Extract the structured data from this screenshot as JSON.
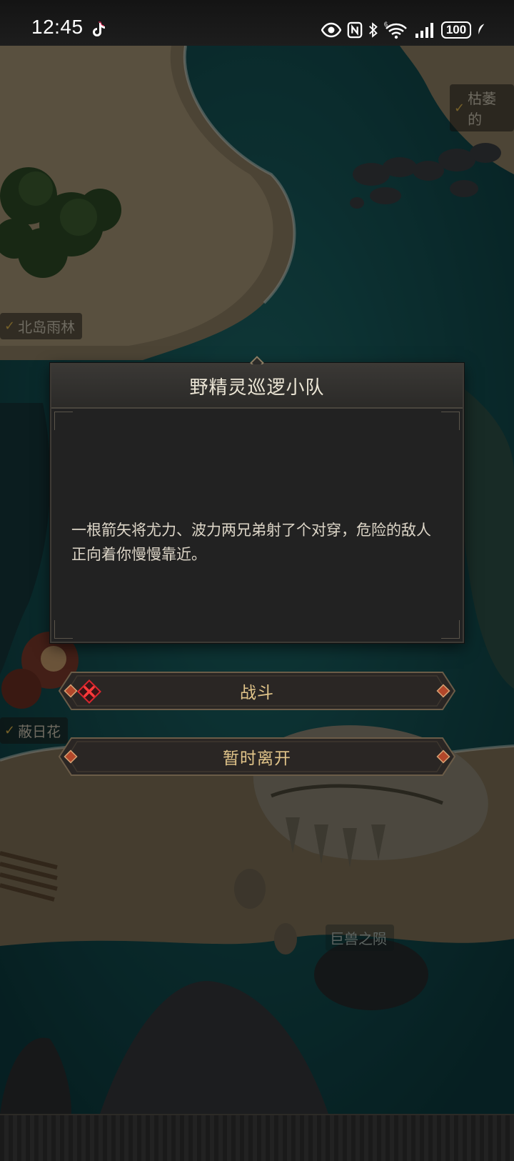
{
  "status_bar": {
    "time": "12:45",
    "battery": "100",
    "icons": [
      "tiktok-icon",
      "eye-icon",
      "nfc-icon",
      "bluetooth-icon",
      "wifi-6-icon",
      "signal-icon",
      "battery-icon",
      "leaf-icon"
    ]
  },
  "map": {
    "labels": [
      "枯萎的",
      "北岛雨林",
      "蔽日花",
      "巨兽之陨"
    ]
  },
  "dialog": {
    "title": "野精灵巡逻小队",
    "body": "一根箭矢将尤力、波力两兄弟射了个对穿，危险的敌人正向着你慢慢靠近。"
  },
  "actions": {
    "fight_label": "战斗",
    "leave_label": "暂时离开"
  },
  "colors": {
    "accent_gold": "#e2c58a",
    "danger_red": "#d8262e",
    "dialog_bg": "#222222"
  }
}
